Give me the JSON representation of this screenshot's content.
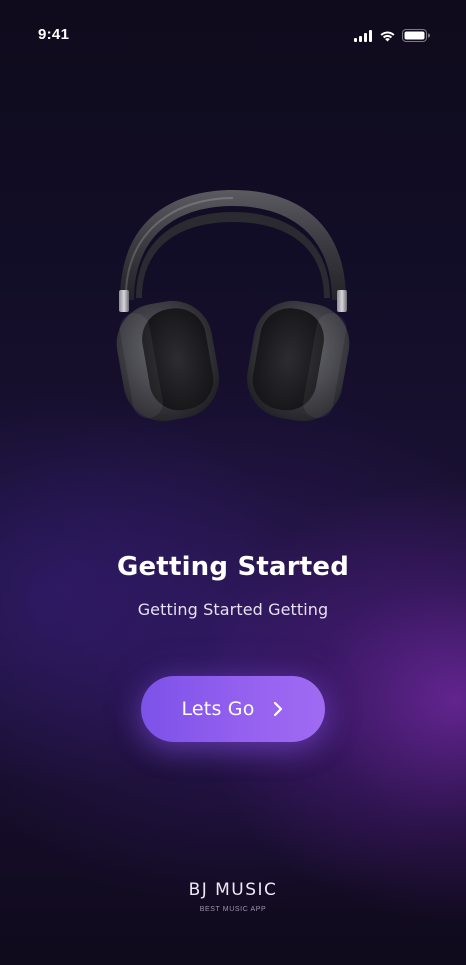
{
  "status_bar": {
    "time": "9:41",
    "icons": [
      "cellular-signal-icon",
      "wifi-icon",
      "battery-icon"
    ]
  },
  "hero": {
    "image": "headphones-icon"
  },
  "onboarding": {
    "title": "Getting Started",
    "subtitle": "Getting Started Getting"
  },
  "cta": {
    "label": "Lets Go",
    "icon": "chevron-right-icon",
    "color_start": "#7c52e8",
    "color_end": "#a06bf2"
  },
  "brand": {
    "name": "BJ MUSIC",
    "tagline": "BEST MUSIC APP"
  },
  "colors": {
    "background": "#120d26",
    "accent_glow": "#782aaa",
    "text_primary": "#ffffff"
  }
}
